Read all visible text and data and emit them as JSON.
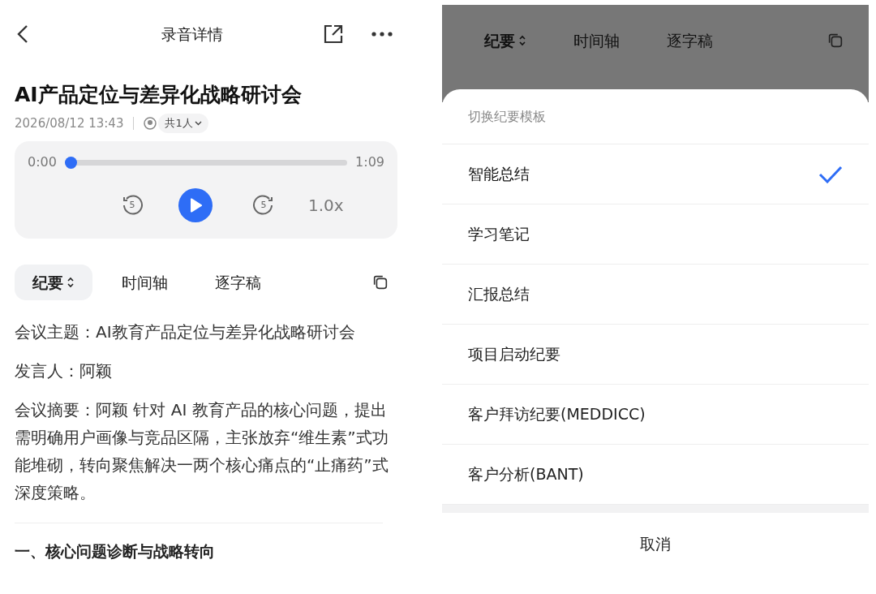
{
  "detail": {
    "header": {
      "title": "录音详情"
    },
    "title": "AI产品定位与差异化战略研讨会",
    "date": "2026/08/12 13:43",
    "participants": "共1人",
    "player": {
      "current": "0:00",
      "total": "1:09",
      "level": 0,
      "back_label": "5",
      "forward_label": "5",
      "speed": "1.0x"
    },
    "tabs": [
      {
        "label": "纪要",
        "selected": true
      },
      {
        "label": "时间轴",
        "selected": false
      },
      {
        "label": "逐字稿",
        "selected": false
      }
    ],
    "paragraphs": [
      "会议主题：AI教育产品定位与差异化战略研讨会",
      "发言人：阿颖",
      "会议摘要：阿颖 针对 AI 教育产品的核心问题，提出需明确用户画像与竞品区隔，主张放弃“维生素”式功能堆砌，转向聚焦解决一两个核心痛点的“止痛药”式深度策略。"
    ],
    "section_heading": "一、核心问题诊断与战略转向"
  },
  "template_sheet": {
    "background_tabs": [
      {
        "label": "纪要",
        "selected": true
      },
      {
        "label": "时间轴",
        "selected": false
      },
      {
        "label": "逐字稿",
        "selected": false
      }
    ],
    "title": "切换纪要模板",
    "options": [
      {
        "label": "智能总结",
        "selected": true
      },
      {
        "label": "学习笔记",
        "selected": false
      },
      {
        "label": "汇报总结",
        "selected": false
      },
      {
        "label": "项目启动纪要",
        "selected": false
      },
      {
        "label": "客户拜访纪要(MEDDICC)",
        "selected": false
      },
      {
        "label": "客户分析(BANT)",
        "selected": false
      }
    ],
    "cancel": "取消"
  }
}
